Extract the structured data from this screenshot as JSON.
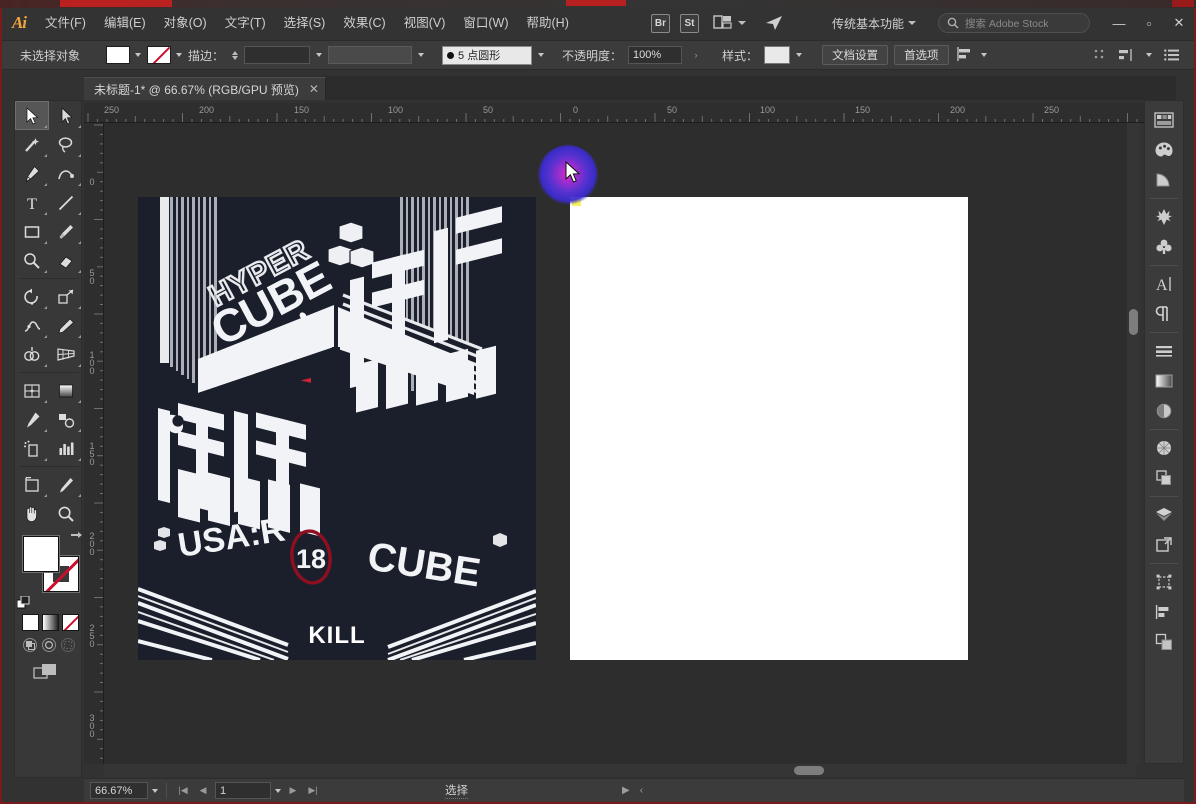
{
  "app": {
    "name": "Adobe Illustrator",
    "logo_text": "Ai"
  },
  "menubar": {
    "items": [
      {
        "label": "文件(F)",
        "name": "menu-file"
      },
      {
        "label": "编辑(E)",
        "name": "menu-edit"
      },
      {
        "label": "对象(O)",
        "name": "menu-object"
      },
      {
        "label": "文字(T)",
        "name": "menu-type"
      },
      {
        "label": "选择(S)",
        "name": "menu-select"
      },
      {
        "label": "效果(C)",
        "name": "menu-effect"
      },
      {
        "label": "视图(V)",
        "name": "menu-view"
      },
      {
        "label": "窗口(W)",
        "name": "menu-window"
      },
      {
        "label": "帮助(H)",
        "name": "menu-help"
      }
    ],
    "bridge_label": "Br",
    "stock_label": "St",
    "workspace": "传统基本功能",
    "search_placeholder": "搜索 Adobe Stock",
    "window_buttons": {
      "minimize": "—",
      "maximize": "▫",
      "close": "✕"
    }
  },
  "controlbar": {
    "selection_status": "未选择对象",
    "stroke_label": "描边：",
    "stroke_weight": "",
    "brush_label": "5 点圆形",
    "opacity_label": "不透明度：",
    "opacity_value": "100%",
    "style_label": "样式：",
    "document_setup": "文档设置",
    "preferences": "首选项"
  },
  "tabs": {
    "documents": [
      {
        "title": "未标题-1* @ 66.67% (RGB/GPU 预览)",
        "close": "✕",
        "active": true
      }
    ]
  },
  "toolbar": {
    "tools": [
      {
        "name": "selection-tool",
        "label": "选择工具",
        "active": true
      },
      {
        "name": "direct-selection-tool",
        "label": "直接选择工具"
      },
      {
        "name": "magic-wand-tool",
        "label": "魔棒工具"
      },
      {
        "name": "lasso-tool",
        "label": "套索工具"
      },
      {
        "name": "pen-tool",
        "label": "钢笔工具"
      },
      {
        "name": "curvature-tool",
        "label": "曲率工具"
      },
      {
        "name": "type-tool",
        "label": "文字工具"
      },
      {
        "name": "line-segment-tool",
        "label": "直线段工具"
      },
      {
        "name": "rectangle-tool",
        "label": "矩形工具"
      },
      {
        "name": "paintbrush-tool",
        "label": "画笔工具"
      },
      {
        "name": "shaper-tool",
        "label": "Shaper 工具"
      },
      {
        "name": "eraser-tool",
        "label": "橡皮擦工具"
      },
      {
        "name": "rotate-tool",
        "label": "旋转工具"
      },
      {
        "name": "scale-tool",
        "label": "比例缩放工具"
      },
      {
        "name": "width-tool",
        "label": "宽度工具"
      },
      {
        "name": "free-transform-tool",
        "label": "自由变换工具"
      },
      {
        "name": "shape-builder-tool",
        "label": "形状生成器工具"
      },
      {
        "name": "perspective-grid-tool",
        "label": "透视网格工具"
      },
      {
        "name": "mesh-tool",
        "label": "网格工具"
      },
      {
        "name": "gradient-tool",
        "label": "渐变工具"
      },
      {
        "name": "eyedropper-tool",
        "label": "吸管工具"
      },
      {
        "name": "blend-tool",
        "label": "混合工具"
      },
      {
        "name": "symbol-sprayer-tool",
        "label": "符号喷枪工具"
      },
      {
        "name": "column-graph-tool",
        "label": "柱形图工具"
      },
      {
        "name": "artboard-tool",
        "label": "画板工具"
      },
      {
        "name": "slice-tool",
        "label": "切片工具"
      },
      {
        "name": "hand-tool",
        "label": "抓手工具"
      },
      {
        "name": "zoom-tool",
        "label": "缩放工具"
      }
    ],
    "fill_color": "#ffffff",
    "stroke_color": "#ffffff",
    "stroke_is_none": true,
    "color_modes": [
      "color-swatch",
      "gradient-swatch",
      "none-swatch"
    ],
    "draw_modes": [
      "draw-normal",
      "draw-behind",
      "draw-inside"
    ],
    "screen_mode": "screen-mode-button"
  },
  "rulers": {
    "unit": "mm",
    "horizontal_labels": [
      "250",
      "200",
      "150",
      "100",
      "50",
      "0",
      "50",
      "100",
      "150",
      "200",
      "250"
    ],
    "vertical_labels": [
      "0",
      "50",
      "100",
      "150",
      "200",
      "250",
      "300"
    ]
  },
  "canvas": {
    "artwork": {
      "title_line1": "HYPER",
      "title_line2": "CUBE",
      "left_face_text": "USA:R",
      "badge_number": "18",
      "right_face_text": "CUBE",
      "bottom_text": "KILL",
      "bg_color": "#1b1f2b",
      "ink_color": "#ffffff",
      "accent_color": "#c8102e"
    },
    "empty_artboard_color": "#ffffff"
  },
  "rightdock": {
    "panels": [
      {
        "name": "color-panel-icon",
        "label": "颜色"
      },
      {
        "name": "color-guide-panel-icon",
        "label": "颜色参考"
      },
      {
        "name": "color-themes-panel-icon",
        "label": "色板"
      },
      {
        "name": "brushes-panel-icon",
        "label": "画笔"
      },
      {
        "name": "symbols-panel-icon",
        "label": "符号"
      },
      {
        "name": "character-panel-icon",
        "label": "字符"
      },
      {
        "name": "paragraph-panel-icon",
        "label": "段落"
      },
      {
        "name": "stroke-panel-icon",
        "label": "描边"
      },
      {
        "name": "gradient-panel-icon",
        "label": "渐变"
      },
      {
        "name": "appearance-panel-icon",
        "label": "外观"
      },
      {
        "name": "transparency-panel-icon",
        "label": "透明度"
      },
      {
        "name": "pathfinder-panel-icon",
        "label": "路径查找器"
      },
      {
        "name": "layers-panel-icon",
        "label": "图层"
      },
      {
        "name": "links-panel-icon",
        "label": "链接"
      },
      {
        "name": "transform-panel-icon",
        "label": "变换"
      },
      {
        "name": "align-panel-icon",
        "label": "对齐"
      },
      {
        "name": "artboards-panel-icon",
        "label": "画板"
      }
    ]
  },
  "statusbar": {
    "zoom": "66.67%",
    "page": "1",
    "status_text": "选择",
    "first_label": "|◀",
    "prev_label": "◀",
    "next_label": "▶",
    "last_label": "▶|"
  }
}
